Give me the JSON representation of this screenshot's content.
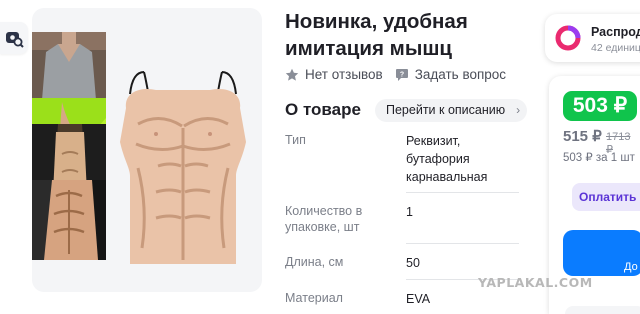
{
  "product": {
    "title": "Новинка, удобная имитация мышц",
    "reviews_label": "Нет отзывов",
    "ask_label": "Задать вопрос"
  },
  "about": {
    "title": "О товаре",
    "goto_description_label": "Перейти к описанию"
  },
  "specs": [
    {
      "key": "Тип",
      "value": "Реквизит, бутафория карнавальная"
    },
    {
      "key": "Количество в упаковке, шт",
      "value": "1"
    },
    {
      "key": "Длина, см",
      "value": "50"
    },
    {
      "key": "Материал",
      "value": "EVA"
    }
  ],
  "seller": {
    "name": "Распрод",
    "count": "42 единиц"
  },
  "price": {
    "current": "503 ₽",
    "old": "515 ₽",
    "crossed": "1713 ₽",
    "unit": "503 ₽ за 1 шт"
  },
  "buttons": {
    "pay_label": "Оплатить п",
    "cart_label": "До"
  },
  "watermark": "YAPLAKAL.COM",
  "colors": {
    "price_green": "#10c44c",
    "cart_blue": "#0a7cff",
    "pay_purple": "#5b34d6",
    "seller_logo_pink": "#ea2a6f"
  },
  "icons": [
    "photo-search-icon",
    "star-icon",
    "question-chat-icon",
    "chevron-right-icon"
  ]
}
